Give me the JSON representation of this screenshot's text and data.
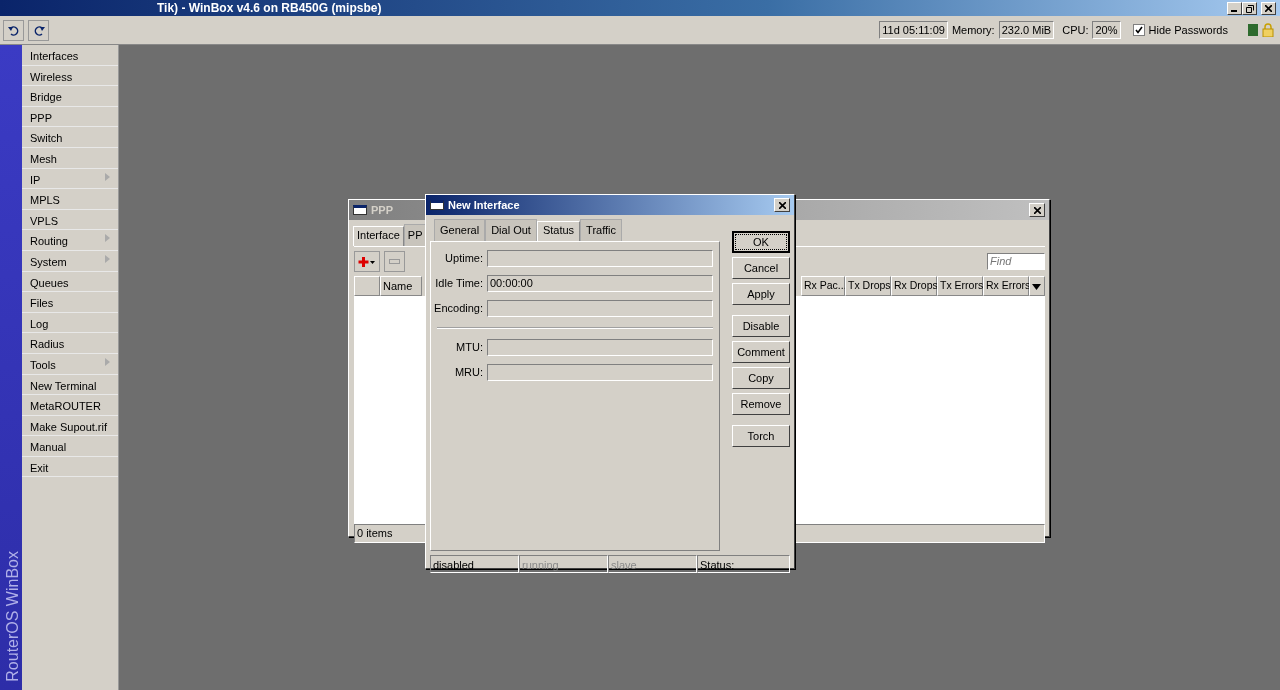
{
  "window": {
    "title": "Tik) - WinBox v4.6 on RB450G (mipsbe)"
  },
  "toolbar": {
    "uptime": "11d 05:11:09",
    "memory_label": "Memory:",
    "memory": "232.0 MiB",
    "cpu_label": "CPU:",
    "cpu": "20%",
    "hide_passwords": {
      "label": "Hide Passwords",
      "checked": true
    }
  },
  "side_label": "RouterOS WinBox",
  "menu": [
    {
      "label": "Interfaces",
      "has_submenu": false
    },
    {
      "label": "Wireless",
      "has_submenu": false
    },
    {
      "label": "Bridge",
      "has_submenu": false
    },
    {
      "label": "PPP",
      "has_submenu": false
    },
    {
      "label": "Switch",
      "has_submenu": false
    },
    {
      "label": "Mesh",
      "has_submenu": false
    },
    {
      "label": "IP",
      "has_submenu": true
    },
    {
      "label": "MPLS",
      "has_submenu": false
    },
    {
      "label": "VPLS",
      "has_submenu": false
    },
    {
      "label": "Routing",
      "has_submenu": true
    },
    {
      "label": "System",
      "has_submenu": true
    },
    {
      "label": "Queues",
      "has_submenu": false
    },
    {
      "label": "Files",
      "has_submenu": false
    },
    {
      "label": "Log",
      "has_submenu": false
    },
    {
      "label": "Radius",
      "has_submenu": false
    },
    {
      "label": "Tools",
      "has_submenu": true
    },
    {
      "label": "New Terminal",
      "has_submenu": false
    },
    {
      "label": "MetaROUTER",
      "has_submenu": false
    },
    {
      "label": "Make Supout.rif",
      "has_submenu": false
    },
    {
      "label": "Manual",
      "has_submenu": false
    },
    {
      "label": "Exit",
      "has_submenu": false
    }
  ],
  "ppp_window": {
    "title": "PPP",
    "tabs": [
      {
        "label": "Interface",
        "selected": true
      },
      {
        "label": "PP",
        "selected": false
      }
    ],
    "find": {
      "placeholder": "Find"
    },
    "columns_left": [
      "Name"
    ],
    "columns_right": [
      "Rx Pac...",
      "Tx Drops",
      "Rx Drops",
      "Tx Errors",
      "Rx Errors"
    ],
    "footer": "0 items"
  },
  "dialog": {
    "title": "New Interface",
    "tabs": [
      {
        "label": "General",
        "selected": false
      },
      {
        "label": "Dial Out",
        "selected": false
      },
      {
        "label": "Status",
        "selected": true
      },
      {
        "label": "Traffic",
        "selected": false
      }
    ],
    "fields": [
      {
        "label": "Uptime:",
        "separator_before": false
      },
      {
        "label": "Idle Time:",
        "value": "00:00:00",
        "separator_before": false
      },
      {
        "label": "Encoding:",
        "separator_before": false
      },
      {
        "label": "MTU:",
        "separator_before": true
      },
      {
        "label": "MRU:",
        "separator_before": false
      }
    ],
    "button_groups": [
      [
        {
          "label": "OK",
          "default": true
        },
        {
          "label": "Cancel",
          "default": false
        },
        {
          "label": "Apply",
          "default": false
        }
      ],
      [
        {
          "label": "Disable",
          "default": false
        },
        {
          "label": "Comment",
          "default": false
        },
        {
          "label": "Copy",
          "default": false
        },
        {
          "label": "Remove",
          "default": false
        }
      ],
      [
        {
          "label": "Torch",
          "default": false
        }
      ]
    ],
    "status_bar": [
      {
        "text": "disabled",
        "active": true
      },
      {
        "text": "running",
        "active": false
      },
      {
        "text": "slave",
        "active": false
      },
      {
        "text": "Status:",
        "active": true
      }
    ]
  }
}
